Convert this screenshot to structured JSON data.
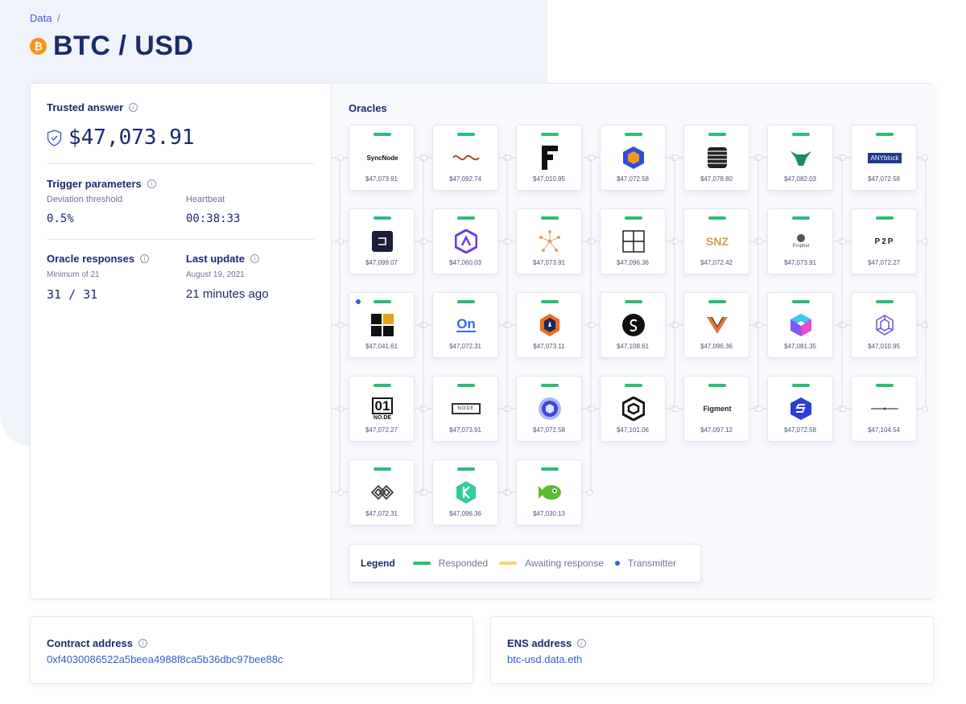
{
  "breadcrumb": {
    "parent": "Data",
    "separator": "/"
  },
  "header": {
    "title": "BTC / USD",
    "icon": "bitcoin-icon",
    "icon_glyph": "₿"
  },
  "trusted_answer": {
    "label": "Trusted answer",
    "value": "$47,073.91"
  },
  "trigger": {
    "label": "Trigger parameters",
    "deviation_label": "Deviation threshold",
    "deviation_value": "0.5%",
    "heartbeat_label": "Heartbeat",
    "heartbeat_value": "00:38:33"
  },
  "responses": {
    "label": "Oracle responses",
    "sub": "Minimum of 21",
    "value": "31 / 31"
  },
  "last_update": {
    "label": "Last update",
    "sub": "August 19, 2021",
    "value": "21 minutes ago"
  },
  "oracles": {
    "title": "Oracles",
    "items": [
      {
        "logo": "syncnode",
        "price": "$47,073.91"
      },
      {
        "logo": "wave",
        "price": "$47,092.74"
      },
      {
        "logo": "fiews",
        "price": "$47,010.95"
      },
      {
        "logo": "hexagon-blue",
        "price": "$47,072.58"
      },
      {
        "logo": "stripes",
        "price": "$47,078.80"
      },
      {
        "logo": "bull",
        "price": "$47,082.03"
      },
      {
        "logo": "anyblock",
        "price": "$47,072.58"
      },
      {
        "logo": "dark-square",
        "price": "$47,099.07"
      },
      {
        "logo": "purple-hex",
        "price": "$47,060.03"
      },
      {
        "logo": "network-star",
        "price": "$47,073.91"
      },
      {
        "logo": "grid-square",
        "price": "$47,096.36"
      },
      {
        "logo": "snz",
        "price": "$47,072.42"
      },
      {
        "logo": "prophet",
        "price": "$47,073.91"
      },
      {
        "logo": "p2p",
        "price": "$47,072.27"
      },
      {
        "logo": "blocks",
        "price": "$47,041.61",
        "transmitter": true
      },
      {
        "logo": "on",
        "price": "$47,072.31"
      },
      {
        "logo": "orange-hex",
        "price": "$47,073.11"
      },
      {
        "logo": "black-circle",
        "price": "$47,108.61"
      },
      {
        "logo": "v-logo",
        "price": "$47,096.36"
      },
      {
        "logo": "cube",
        "price": "$47,081.35"
      },
      {
        "logo": "knot",
        "price": "$47,010.95"
      },
      {
        "logo": "01node",
        "price": "$47,072.27"
      },
      {
        "logo": "box-logo",
        "price": "$47,073.91"
      },
      {
        "logo": "blue-blob",
        "price": "$47,072.58"
      },
      {
        "logo": "hex-outline",
        "price": "$47,101.06"
      },
      {
        "logo": "figment",
        "price": "$47,097.12"
      },
      {
        "logo": "blue-s",
        "price": "$47,072.58"
      },
      {
        "logo": "thin-line",
        "price": "$47,104.54"
      },
      {
        "logo": "diamonds",
        "price": "$47,072.31"
      },
      {
        "logo": "kyber",
        "price": "$47,096.36"
      },
      {
        "logo": "green-fish",
        "price": "$47,030.13"
      }
    ],
    "labels": {
      "syncnode": "SyncNode",
      "anyblock": "ANYblock",
      "snz": "SNZ",
      "prophet": "Prophet",
      "p2p": "P2P",
      "on": "On",
      "01node_top": "01",
      "01node_bottom": "NO.DE",
      "figment": "Figment",
      "box": "NODE"
    }
  },
  "legend": {
    "title": "Legend",
    "responded": "Responded",
    "awaiting": "Awaiting response",
    "transmitter": "Transmitter",
    "colors": {
      "responded": "#2bbd76",
      "awaiting": "#f5d76e",
      "transmitter": "#375bd2"
    }
  },
  "contract": {
    "label": "Contract address",
    "value": "0xf4030086522a5beea4988f8ca5b36dbc97bee88c"
  },
  "ens": {
    "label": "ENS address",
    "value": "btc-usd.data.eth"
  }
}
